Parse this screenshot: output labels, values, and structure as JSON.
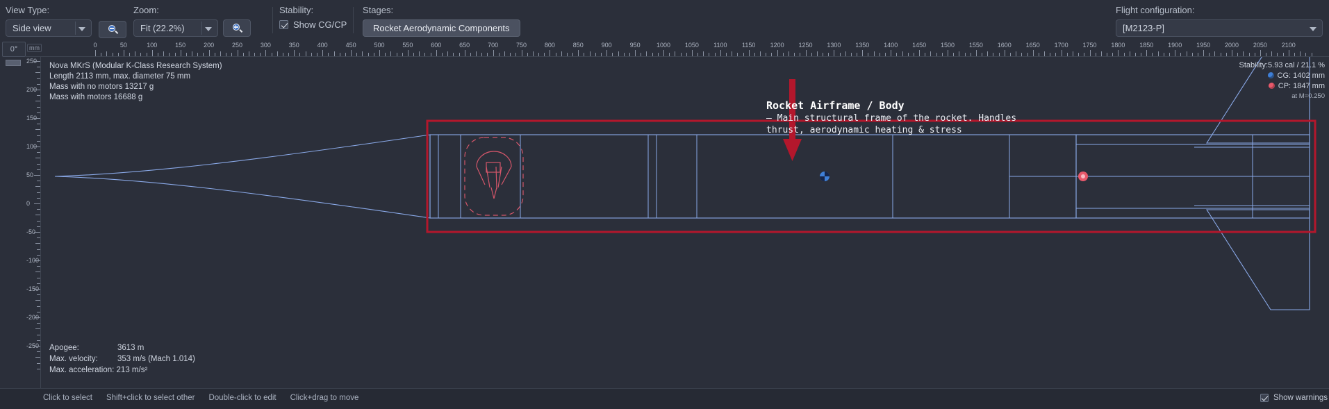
{
  "toolbar": {
    "view_type": {
      "label": "View Type:",
      "value": "Side view"
    },
    "zoom": {
      "label": "Zoom:",
      "value": "Fit (22.2%)",
      "zoom_out_icon": "zoom-out-icon",
      "zoom_in_icon": "zoom-in-icon"
    },
    "stability": {
      "label": "Stability:",
      "checkbox_label": "Show CG/CP",
      "checked": true
    },
    "stages": {
      "label": "Stages:",
      "chip": "Rocket Aerodynamic Components"
    },
    "flight_configuration": {
      "label": "Flight configuration:",
      "value": "[M2123-P]"
    }
  },
  "rulers": {
    "angle_box": "0°",
    "unit": "mm",
    "h_labels": [
      0,
      50,
      100,
      150,
      200,
      250,
      300,
      350,
      400,
      450,
      500,
      550,
      600,
      650,
      700,
      750,
      800,
      850,
      900,
      950,
      1000,
      1050,
      1100,
      1150,
      1200,
      1250,
      1300,
      1350,
      1400,
      1450,
      1500,
      1550,
      1600,
      1650,
      1700,
      1750,
      1800,
      1850,
      1900,
      1950,
      2000,
      2050,
      2100
    ],
    "v_labels": [
      250,
      200,
      150,
      100,
      50,
      0,
      -50,
      -100,
      -150,
      -200,
      -250
    ]
  },
  "design_info": {
    "name": "Nova MKrS (Modular K-Class Research System)",
    "dimensions": "Length 2113 mm, max. diameter 75 mm",
    "mass_no_motors": "Mass with no motors 13217 g",
    "mass_with_motors": "Mass with motors 16688 g"
  },
  "stability_readout": {
    "stability": "Stability:5.93 cal / 21.1 %",
    "cg": "CG: 1402 mm",
    "cp": "CP: 1847 mm",
    "mach_note": "at M=0.250",
    "cg_icon": "cg-marker-icon",
    "cp_icon": "cp-marker-icon"
  },
  "performance": {
    "apogee_key": "Apogee:",
    "apogee_value": "3613 m",
    "velocity_key": "Max. velocity:",
    "velocity_value": "353 m/s  (Mach 1.014)",
    "acceleration_key": "Max. acceleration:",
    "acceleration_value": "213 m/s²"
  },
  "annotation": {
    "title": "Rocket Airframe / Body",
    "line1": "– Main structural frame of the rocket. Handles",
    "line2": "thrust, aerodynamic heating & stress",
    "marker_icon": "down-arrow-marker-icon"
  },
  "status_bar": {
    "hints": [
      "Click to select",
      "Shift+click to select other",
      "Double-click to edit",
      "Click+drag to move"
    ],
    "show_warnings_label": "Show warnings",
    "show_warnings_checked": true
  },
  "colors": {
    "background": "#2b2f3a",
    "outline_blue": "#8aa9e8",
    "selection_red": "#b3172c",
    "parachute_red": "#d4566a",
    "cg_blue": "#3f7fd6",
    "cp_red": "#e8596b",
    "text": "#cfd5e0"
  }
}
